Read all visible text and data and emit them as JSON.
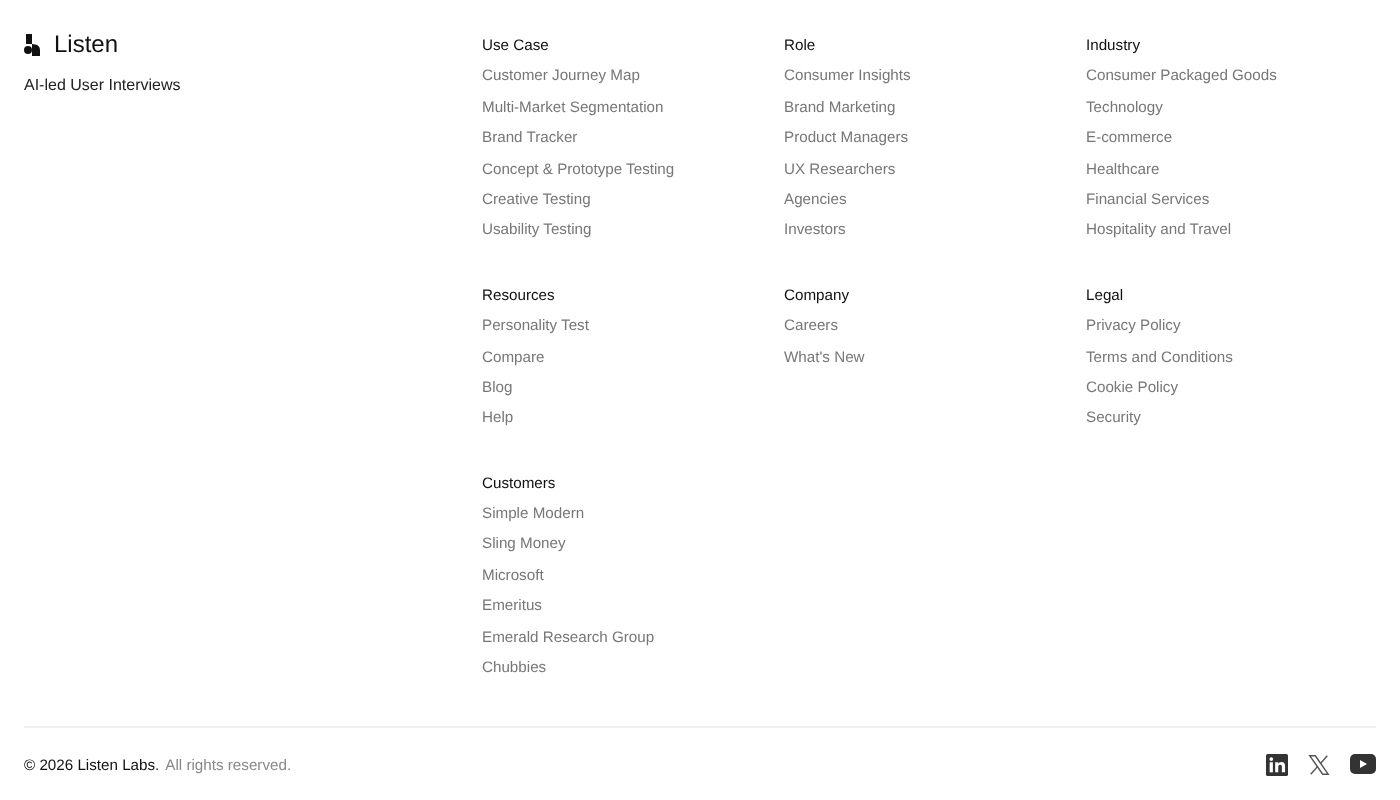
{
  "brand": {
    "name": "Listen",
    "tagline": "AI-led User Interviews"
  },
  "sections": [
    {
      "title": "Use Case",
      "links": [
        "Customer Journey Map",
        "Multi-Market Segmentation",
        "Brand Tracker",
        "Concept & Prototype Testing",
        "Creative Testing",
        "Usability Testing"
      ]
    },
    {
      "title": "Role",
      "links": [
        "Consumer Insights",
        "Brand Marketing",
        "Product Managers",
        "UX Researchers",
        "Agencies",
        "Investors"
      ]
    },
    {
      "title": "Industry",
      "links": [
        "Consumer Packaged Goods",
        "Technology",
        "E-commerce",
        "Healthcare",
        "Financial Services",
        "Hospitality and Travel"
      ]
    },
    {
      "title": "Resources",
      "links": [
        "Personality Test",
        "Compare",
        "Blog",
        "Help"
      ]
    },
    {
      "title": "Company",
      "links": [
        "Careers",
        "What's New"
      ]
    },
    {
      "title": "Legal",
      "links": [
        "Privacy Policy",
        "Terms and Conditions",
        "Cookie Policy",
        "Security"
      ]
    },
    {
      "title": "Customers",
      "links": [
        "Simple Modern",
        "Sling Money",
        "Microsoft",
        "Emeritus",
        "Emerald Research Group",
        "Chubbies"
      ]
    }
  ],
  "footer": {
    "copyright": "© 2026 Listen Labs.",
    "rights": "All rights reserved.",
    "social": [
      {
        "kind": "linkedin"
      },
      {
        "kind": "x"
      },
      {
        "kind": "youtube"
      }
    ]
  }
}
